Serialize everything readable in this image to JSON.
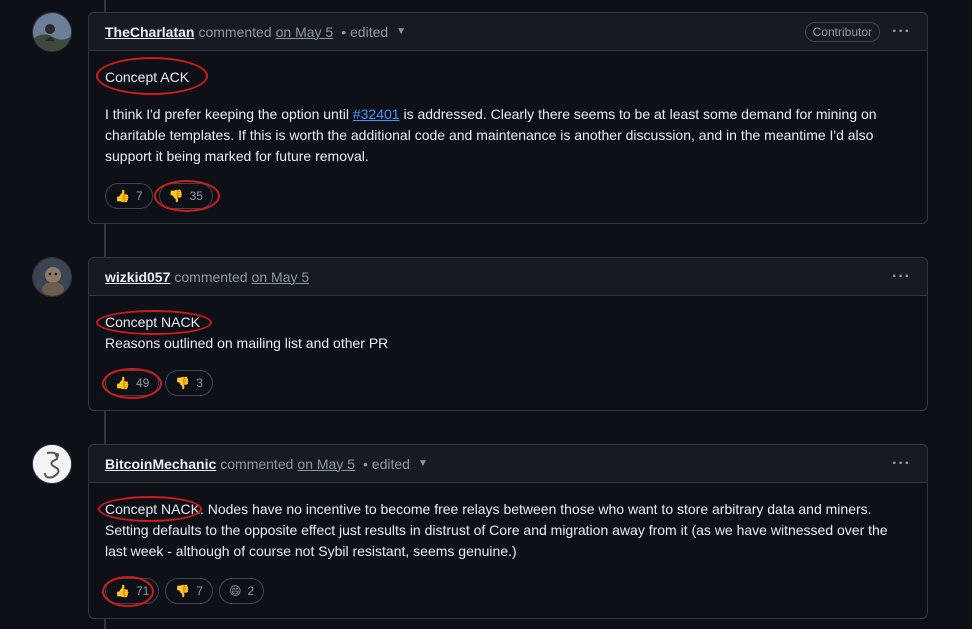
{
  "comments": [
    {
      "author": "TheCharlatan",
      "action": "commented",
      "date": "on May 5",
      "edited": "• edited",
      "badge": "Contributor",
      "heading": "Concept ACK",
      "body_before": "I think I'd prefer keeping the option until ",
      "body_link": "#32401",
      "body_after": " is addressed. Clearly there seems to be at least some demand for mining on charitable templates. If this is worth the additional code and maintenance is another discussion, and in the meantime I'd also support it being marked for future removal.",
      "reactions": [
        {
          "emoji": "👍",
          "count": "7"
        },
        {
          "emoji": "👎",
          "count": "35"
        }
      ]
    },
    {
      "author": "wizkid057",
      "action": "commented",
      "date": "on May 5",
      "heading": "Concept NACK",
      "body": "Reasons outlined on mailing list and other PR",
      "reactions": [
        {
          "emoji": "👍",
          "count": "49"
        },
        {
          "emoji": "👎",
          "count": "3"
        }
      ]
    },
    {
      "author": "BitcoinMechanic",
      "action": "commented",
      "date": "on May 5",
      "edited": "• edited",
      "heading": "Concept NACK.",
      "body": " Nodes have no incentive to become free relays between those who want to store arbitrary data and miners. Setting defaults to the opposite effect just results in distrust of Core and migration away from it (as we have witnessed over the last week - although of course not Sybil resistant, seems genuine.)",
      "reactions": [
        {
          "emoji": "👍",
          "count": "71"
        },
        {
          "emoji": "👎",
          "count": "7"
        },
        {
          "emoji": "😄",
          "count": "2"
        }
      ]
    }
  ],
  "icons": {
    "more": "kebab-horizontal-icon",
    "caret": "triangle-down-icon"
  },
  "colors": {
    "background": "#0d1117",
    "header": "#161b22",
    "border": "#30363d",
    "link": "#4493f8",
    "annotation": "#d11a1a"
  }
}
